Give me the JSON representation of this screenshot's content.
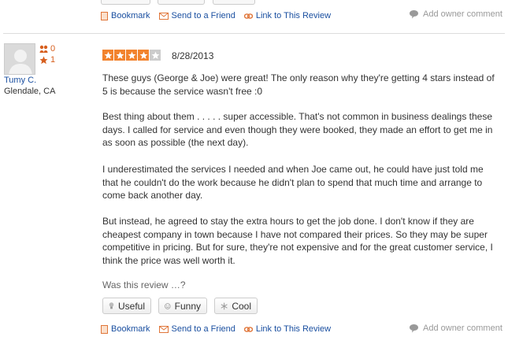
{
  "actions_top": {
    "bookmark": "Bookmark",
    "send": "Send to a Friend",
    "link": "Link to This Review",
    "owner": "Add owner comment"
  },
  "reviewer": {
    "name": "Tumy C.",
    "location": "Glendale, CA",
    "friends": "0",
    "reviews": "1"
  },
  "review": {
    "rating": 4,
    "max_rating": 5,
    "date": "8/28/2013",
    "paragraphs": [
      "These guys (George & Joe) were great! The only reason why they're getting 4 stars instead of 5 is because the service wasn't free :0",
      "Best thing about them . . . . . super accessible.  That's not common in business dealings these days. I called for service and even though they were booked, they made an effort to get me in as soon as possible (the next day).",
      "I underestimated the services I needed and when Joe came out, he could have just told me that he couldn't do the work because he didn't plan to spend that much time and arrange to come back another day.",
      "But instead, he agreed to stay the extra hours to get the job done. I don't know if they are cheapest company in town because I have not compared their prices. So they may be super competitive in pricing. But for sure, they're not expensive and for the great customer service, I think the price was well worth it."
    ]
  },
  "vote": {
    "prompt": "Was this review …?",
    "useful": "Useful",
    "funny": "Funny",
    "cool": "Cool"
  },
  "actions_bottom": {
    "bookmark": "Bookmark",
    "send": "Send to a Friend",
    "link": "Link to This Review",
    "owner": "Add owner comment"
  },
  "colors": {
    "link": "#1a4fa0",
    "accent": "#f2832d",
    "star_empty": "#cccccc"
  }
}
